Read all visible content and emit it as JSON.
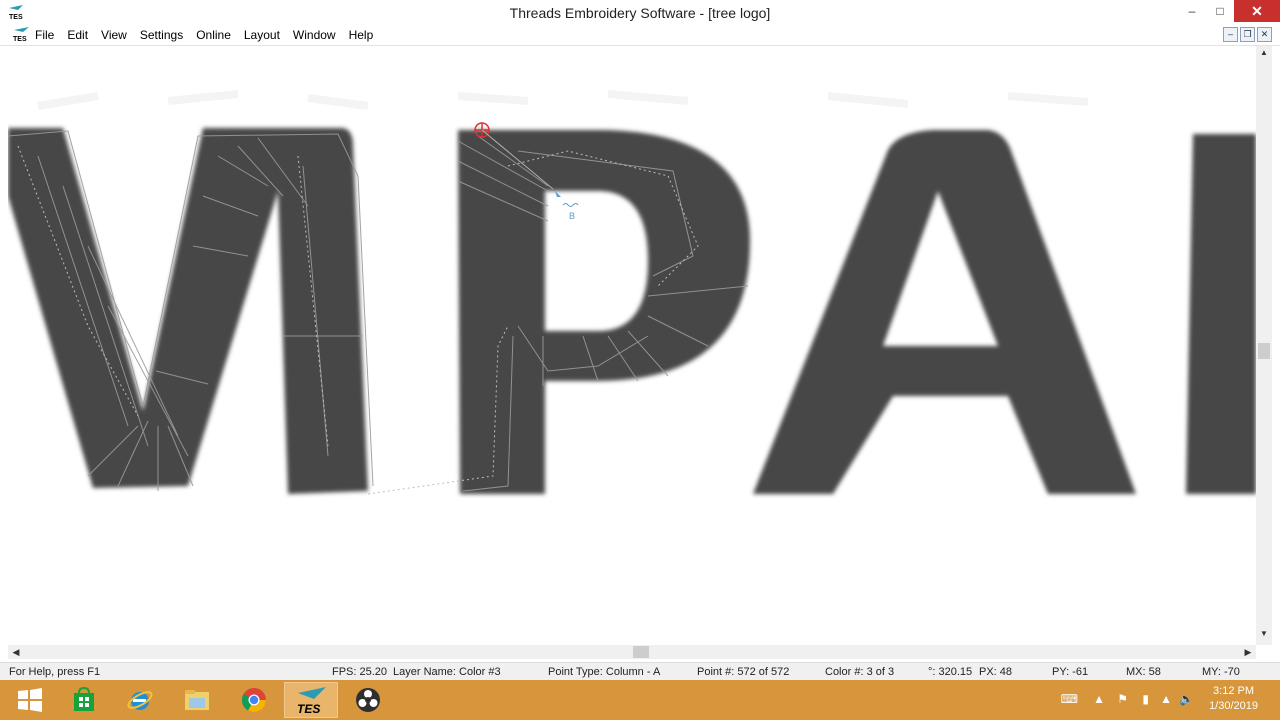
{
  "window": {
    "title": "Threads Embroidery Software - [tree logo]",
    "app_icon": "tes-logo-icon",
    "controls": [
      "minimize-icon",
      "maximize-icon",
      "close-icon"
    ]
  },
  "menubar": {
    "items": [
      {
        "label": "File"
      },
      {
        "label": "Edit"
      },
      {
        "label": "View"
      },
      {
        "label": "Settings"
      },
      {
        "label": "Online"
      },
      {
        "label": "Layout"
      },
      {
        "label": "Window"
      },
      {
        "label": "Help"
      }
    ]
  },
  "canvas": {
    "design_text": "MPAR",
    "point_marker_label": "B",
    "fill_color": "#474747",
    "selection_color": "#e03030"
  },
  "statusbar": {
    "help": "For Help, press F1",
    "fps": "FPS: 25.20",
    "layer": "Layer Name: Color #3",
    "point_type": "Point Type: Column - A",
    "point_num": "Point #: 572 of 572",
    "color_num": "Color #: 3 of 3",
    "angle": "°: 320.15",
    "px": "PX: 48",
    "py": "PY: -61",
    "mx": "MX:  58",
    "my": "MY:  -70"
  },
  "taskbar": {
    "apps": [
      "windows-start-icon",
      "store-icon",
      "internet-explorer-icon",
      "file-explorer-icon",
      "chrome-icon",
      "tes-app-icon",
      "obs-icon"
    ],
    "time": "3:12 PM",
    "date": "1/30/2019",
    "accent": "#d7963b"
  }
}
